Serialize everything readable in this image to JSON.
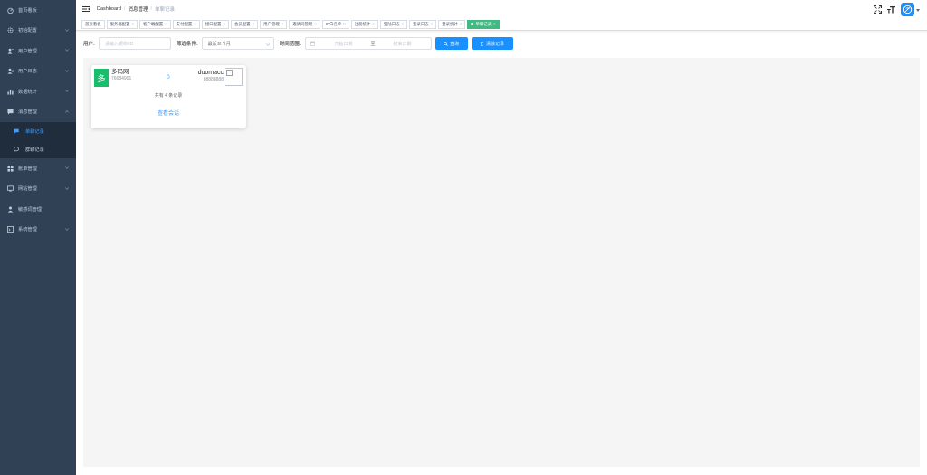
{
  "sidebar": {
    "items": [
      {
        "label": "首页看板",
        "icon": "dashboard-icon",
        "arrow": false
      },
      {
        "label": "初始配置",
        "icon": "settings-gear-icon",
        "arrow": true
      },
      {
        "label": "用户管理",
        "icon": "user-icon",
        "arrow": true
      },
      {
        "label": "用户日志",
        "icon": "user-log-icon",
        "arrow": true
      },
      {
        "label": "数据统计",
        "icon": "bar-chart-icon",
        "arrow": true
      },
      {
        "label": "消息管理",
        "icon": "message-icon",
        "arrow": true,
        "open": true
      },
      {
        "label": "账单管理",
        "icon": "bill-icon",
        "arrow": true
      },
      {
        "label": "网站管理",
        "icon": "website-icon",
        "arrow": true
      },
      {
        "label": "敏感词管理",
        "icon": "person-icon",
        "arrow": false
      },
      {
        "label": "系统管理",
        "icon": "system-icon",
        "arrow": true
      }
    ],
    "submenu": [
      {
        "label": "单聊记录",
        "icon": "chat-icon",
        "active": true
      },
      {
        "label": "群聊记录",
        "icon": "group-chat-icon",
        "active": false
      }
    ]
  },
  "breadcrumb": {
    "items": [
      "Dashboard",
      "消息管理",
      "单聊记录"
    ]
  },
  "tags": [
    {
      "label": "首页看板",
      "closable": false,
      "active": false
    },
    {
      "label": "服务器配置",
      "closable": true,
      "active": false
    },
    {
      "label": "客户端配置",
      "closable": true,
      "active": false
    },
    {
      "label": "支付配置",
      "closable": true,
      "active": false
    },
    {
      "label": "接口配置",
      "closable": true,
      "active": false
    },
    {
      "label": "会员配置",
      "closable": true,
      "active": false
    },
    {
      "label": "用户管理",
      "closable": true,
      "active": false
    },
    {
      "label": "邀请码管理",
      "closable": true,
      "active": false
    },
    {
      "label": "IP白名单",
      "closable": true,
      "active": false
    },
    {
      "label": "注册统计",
      "closable": true,
      "active": false
    },
    {
      "label": "登陆日志",
      "closable": true,
      "active": false
    },
    {
      "label": "登录日志",
      "closable": true,
      "active": false
    },
    {
      "label": "登录统计",
      "closable": true,
      "active": false
    },
    {
      "label": "单聊记录",
      "closable": true,
      "active": true
    }
  ],
  "tag_close": "×",
  "filter": {
    "user_label": "用户:",
    "user_placeholder": "请输入昵称/ID",
    "condition_label": "筛选条件:",
    "condition_value": "最近三个月",
    "time_label": "时间范围:",
    "start_placeholder": "开始日期",
    "range_sep": "至",
    "end_placeholder": "结束日期",
    "search_button": "查询",
    "clear_button": "清除记录"
  },
  "cards": [
    {
      "avatar_char": "多",
      "user_name": "多码网",
      "user_id": "76684901",
      "count": "0",
      "target_name": "duomacc",
      "target_id": "88888888",
      "total_text": "共有 4 条记录",
      "link_text": "查看会话"
    }
  ],
  "colors": {
    "sidebar_bg": "#304156",
    "submenu_bg": "#1f2d3d",
    "accent": "#1890ff",
    "tag_active": "#42b983",
    "card_avatar": "#19be6b"
  }
}
